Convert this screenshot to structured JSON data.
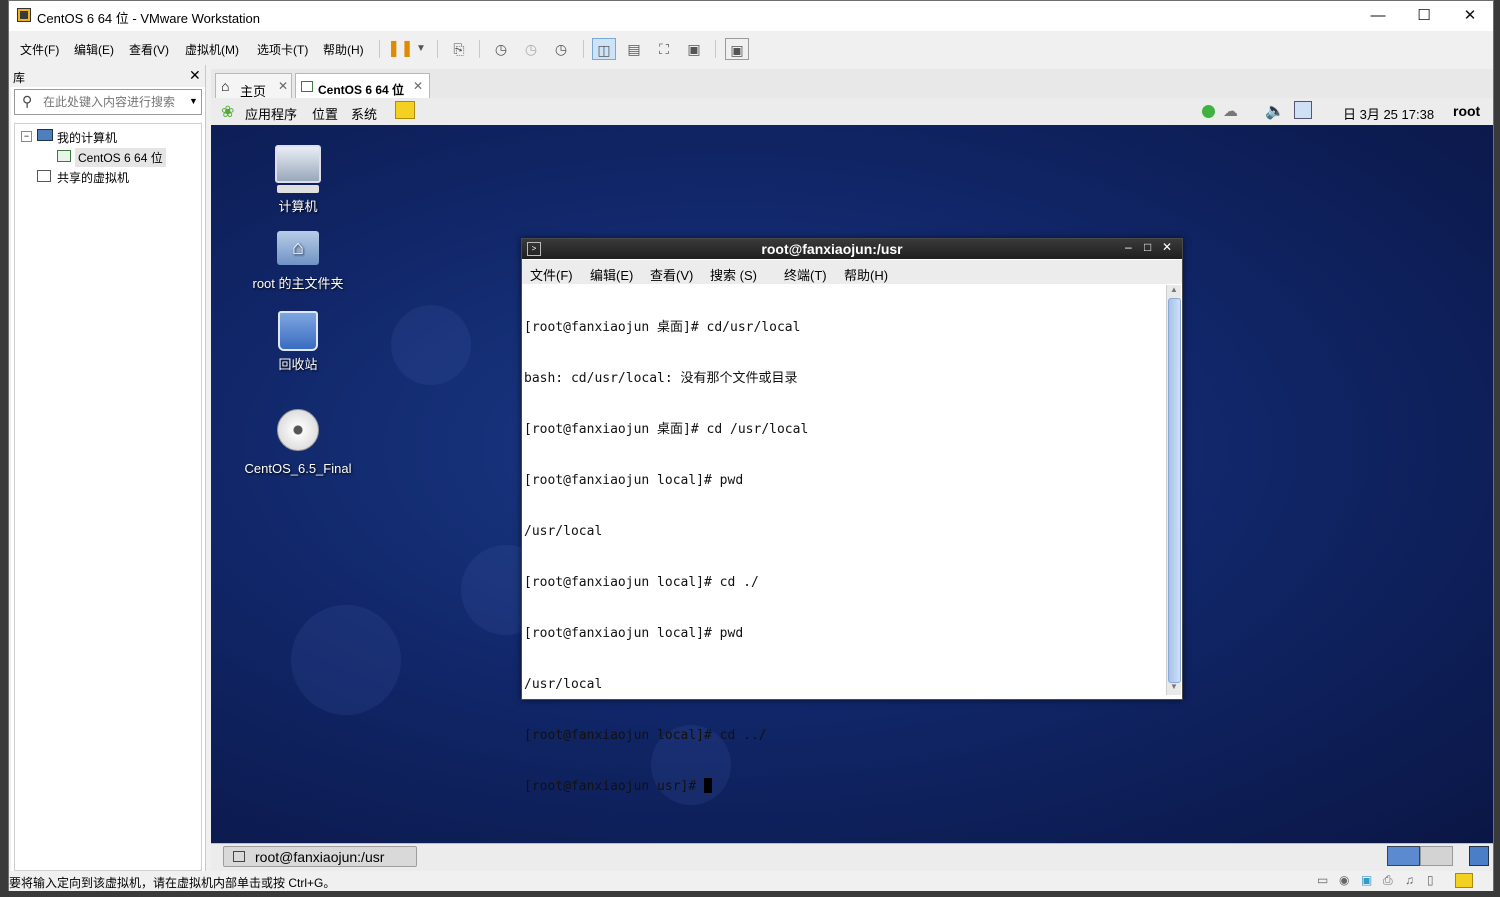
{
  "window": {
    "title": "CentOS 6 64 位 - VMware Workstation"
  },
  "menubar": {
    "items": [
      "文件(F)",
      "编辑(E)",
      "查看(V)",
      "虚拟机(M)",
      "选项卡(T)",
      "帮助(H)"
    ]
  },
  "library": {
    "title": "库",
    "search_placeholder": "在此处键入内容进行搜索",
    "tree": {
      "my_computer": "我的计算机",
      "vm": "CentOS 6 64 位",
      "shared": "共享的虚拟机"
    }
  },
  "tabs": [
    {
      "label": "主页"
    },
    {
      "label": "CentOS 6 64 位"
    }
  ],
  "guest": {
    "panel": {
      "applications": "应用程序",
      "places": "位置",
      "system": "系统",
      "datetime": "日 3月 25 17:38",
      "user": "root"
    },
    "desktop_icons": [
      {
        "label": "计算机"
      },
      {
        "label": "root 的主文件夹"
      },
      {
        "label": "回收站"
      },
      {
        "label": "CentOS_6.5_Final"
      }
    ],
    "taskbar": {
      "item": "root@fanxiaojun:/usr"
    }
  },
  "terminal": {
    "title": "root@fanxiaojun:/usr",
    "menu": [
      "文件(F)",
      "编辑(E)",
      "查看(V)",
      "搜索 (S)",
      "终端(T)",
      "帮助(H)"
    ],
    "lines": [
      "[root@fanxiaojun 桌面]# cd/usr/local",
      "bash: cd/usr/local: 没有那个文件或目录",
      "[root@fanxiaojun 桌面]# cd /usr/local",
      "[root@fanxiaojun local]# pwd",
      "/usr/local",
      "[root@fanxiaojun local]# cd ./",
      "[root@fanxiaojun local]# pwd",
      "/usr/local",
      "[root@fanxiaojun local]# cd ../",
      "[root@fanxiaojun usr]# "
    ]
  },
  "statusbar": {
    "text": "要将输入定向到该虚拟机，请在虚拟机内部单击或按 Ctrl+G。"
  }
}
